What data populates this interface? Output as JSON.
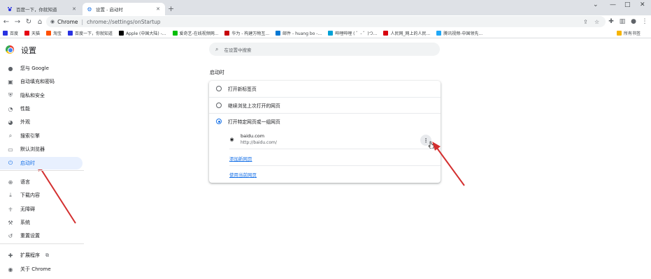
{
  "tabs": [
    {
      "title": "百度一下，你就知道",
      "active": false
    },
    {
      "title": "设置 - 启动时",
      "active": true
    }
  ],
  "toolbar": {
    "chip": "Chrome",
    "url": "chrome://settings/onStartup"
  },
  "bookmarks": [
    {
      "label": "百度",
      "color": "#2932e1"
    },
    {
      "label": "天猫",
      "color": "#e60012"
    },
    {
      "label": "淘宝",
      "color": "#ff5000"
    },
    {
      "label": "百度一下，你就知道",
      "color": "#2932e1"
    },
    {
      "label": "Apple (中国大陆) -...",
      "color": "#000000"
    },
    {
      "label": "爱奇艺-在线视频网...",
      "color": "#00be06"
    },
    {
      "label": "华为 - 构建万物互...",
      "color": "#c7000b"
    },
    {
      "label": "邮件 - huang bo -...",
      "color": "#0078d4"
    },
    {
      "label": "哔哩哔哩 ( ゜- ゜)つ...",
      "color": "#00a1d6"
    },
    {
      "label": "人民网_网上的人民...",
      "color": "#d7000f"
    },
    {
      "label": "腾讯视频-中国领先...",
      "color": "#20a8f7"
    }
  ],
  "bookmarks_right": "所有书签",
  "settings": {
    "title": "设置",
    "search_placeholder": "在设置中搜索"
  },
  "sidebar": [
    {
      "label": "您与 Google",
      "icon": "person-icon",
      "glyph": "●"
    },
    {
      "label": "自动填充和密码",
      "icon": "clipboard-icon",
      "glyph": "▣"
    },
    {
      "label": "隐私和安全",
      "icon": "shield-icon",
      "glyph": "⛨"
    },
    {
      "label": "性能",
      "icon": "speedometer-icon",
      "glyph": "◔"
    },
    {
      "label": "外观",
      "icon": "palette-icon",
      "glyph": "◕"
    },
    {
      "label": "搜索引擎",
      "icon": "search-icon",
      "glyph": "⌕"
    },
    {
      "label": "默认浏览器",
      "icon": "browser-icon",
      "glyph": "▭"
    },
    {
      "label": "启动时",
      "icon": "power-icon",
      "glyph": "⏻",
      "active": true
    },
    {
      "label": "语言",
      "icon": "globe-icon",
      "glyph": "⊕"
    },
    {
      "label": "下载内容",
      "icon": "download-icon",
      "glyph": "⤓"
    },
    {
      "label": "无障碍",
      "icon": "accessibility-icon",
      "glyph": "☥"
    },
    {
      "label": "系统",
      "icon": "wrench-icon",
      "glyph": "⚒"
    },
    {
      "label": "重置设置",
      "icon": "history-icon",
      "glyph": "↺"
    },
    {
      "label": "扩展程序",
      "icon": "puzzle-icon",
      "glyph": "✚"
    },
    {
      "label": "关于 Chrome",
      "icon": "chrome-icon",
      "glyph": "◉"
    }
  ],
  "startup": {
    "section_title": "启动时",
    "options": [
      {
        "label": "打开新标签页",
        "checked": false
      },
      {
        "label": "继续浏览上次打开的网页",
        "checked": false
      },
      {
        "label": "打开特定网页或一组网页",
        "checked": true
      }
    ],
    "site": {
      "name": "baidu.com",
      "url": "http://baidu.com/"
    },
    "add_link": "添加新网页",
    "use_current_link": "使用当前网页"
  },
  "colors": {
    "accent": "#1a73e8",
    "annotation_arrow": "#d32f2f"
  }
}
